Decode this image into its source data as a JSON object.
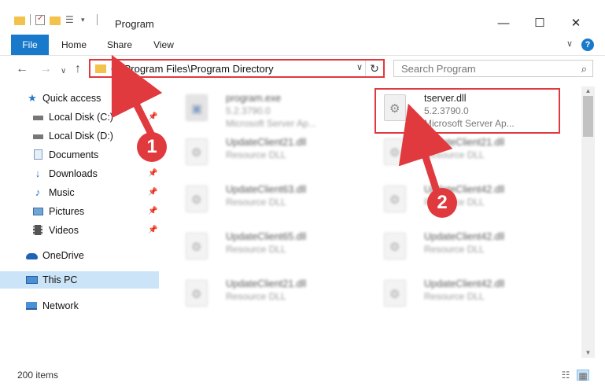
{
  "window": {
    "title": "Program",
    "minimize": "—",
    "maximize": "☐",
    "close": "✕"
  },
  "ribbon": {
    "tabs": [
      "File",
      "Home",
      "Share",
      "View"
    ],
    "help": "?"
  },
  "address": {
    "path": "C:\\Program Files\\Program Directory",
    "dropdown": "∨",
    "refresh": "↻"
  },
  "search": {
    "placeholder": "Search Program",
    "icon": "⌕"
  },
  "nav_glyphs": {
    "back": "←",
    "forward": "→",
    "recent": "∨",
    "up": "↑"
  },
  "sidebar": {
    "items": [
      {
        "label": "Quick access",
        "icon": "star-icon"
      },
      {
        "label": "Local Disk (C:)",
        "icon": "drive-icon"
      },
      {
        "label": "Local Disk (D:)",
        "icon": "drive-icon"
      },
      {
        "label": "Documents",
        "icon": "documents-icon"
      },
      {
        "label": "Downloads",
        "icon": "download-icon"
      },
      {
        "label": "Music",
        "icon": "music-icon"
      },
      {
        "label": "Pictures",
        "icon": "pictures-icon"
      },
      {
        "label": "Videos",
        "icon": "videos-icon"
      },
      {
        "label": "OneDrive",
        "icon": "cloud-icon"
      },
      {
        "label": "This PC",
        "icon": "computer-icon"
      },
      {
        "label": "Network",
        "icon": "network-icon"
      }
    ]
  },
  "files": [
    {
      "name": "program.exe",
      "line2": "5.2.3790.0",
      "line3": "Microsoft Server Ap..."
    },
    {
      "name": "tserver.dll",
      "line2": "5.2.3790.0",
      "line3": "Microsoft Server Ap..."
    },
    {
      "name": "UpdateClient21.dll",
      "line2": "Resource DLL",
      "line3": ""
    },
    {
      "name": "UpdateClient21.dll",
      "line2": "Resource DLL",
      "line3": ""
    },
    {
      "name": "UpdateClient63.dll",
      "line2": "Resource DLL",
      "line3": ""
    },
    {
      "name": "UpdateClient42.dll",
      "line2": "Resource DLL",
      "line3": ""
    },
    {
      "name": "UpdateClient65.dll",
      "line2": "Resource DLL",
      "line3": ""
    },
    {
      "name": "UpdateClient42.dll",
      "line2": "Resource DLL",
      "line3": ""
    },
    {
      "name": "UpdateClient21.dll",
      "line2": "Resource DLL",
      "line3": ""
    },
    {
      "name": "UpdateClient42.dll",
      "line2": "Resource DLL",
      "line3": ""
    }
  ],
  "status": {
    "item_count": "200 items"
  },
  "annotations": {
    "step1": "1",
    "step2": "2",
    "color": "#e0393e"
  },
  "colors": {
    "accent": "#1979ca",
    "folder": "#f2c24b",
    "selected": "#cce4f7"
  }
}
